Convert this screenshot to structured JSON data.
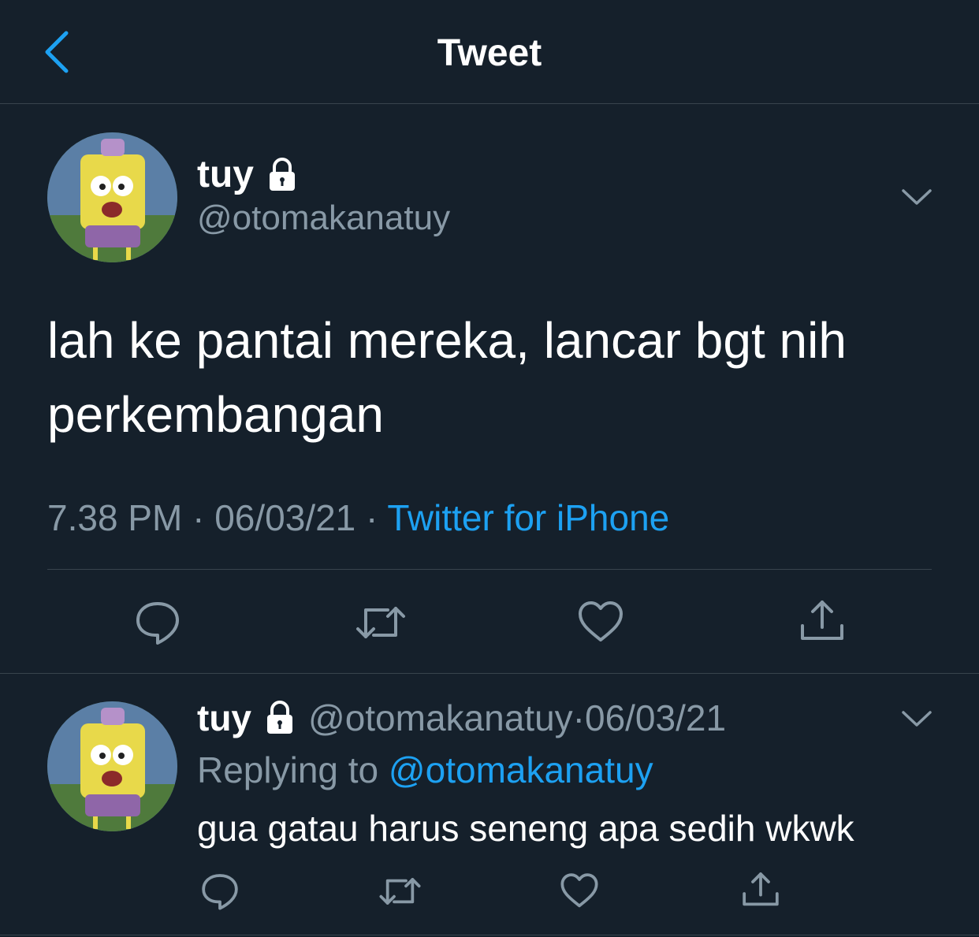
{
  "header": {
    "title": "Tweet"
  },
  "tweet": {
    "name": "tuy",
    "handle": "@otomakanatuy",
    "text": "lah ke pantai mereka, lancar bgt nih perkembangan",
    "time": "7.38 PM",
    "date": "06/03/21",
    "separator": " · ",
    "source": "Twitter for iPhone"
  },
  "reply": {
    "name": "tuy",
    "handle": "@otomakanatuy",
    "separator": " · ",
    "date": "06/03/21",
    "replying_label": "Replying to ",
    "replying_to": "@otomakanatuy",
    "text": "gua gatau harus seneng apa sedih wkwk"
  },
  "colors": {
    "background": "#15202b",
    "accent": "#1da1f2",
    "secondary_text": "#8899a6",
    "divider": "#38444d"
  },
  "icons": [
    "back-chevron-icon",
    "lock-icon",
    "chevron-down-icon",
    "reply-icon",
    "retweet-icon",
    "like-icon",
    "share-icon"
  ]
}
